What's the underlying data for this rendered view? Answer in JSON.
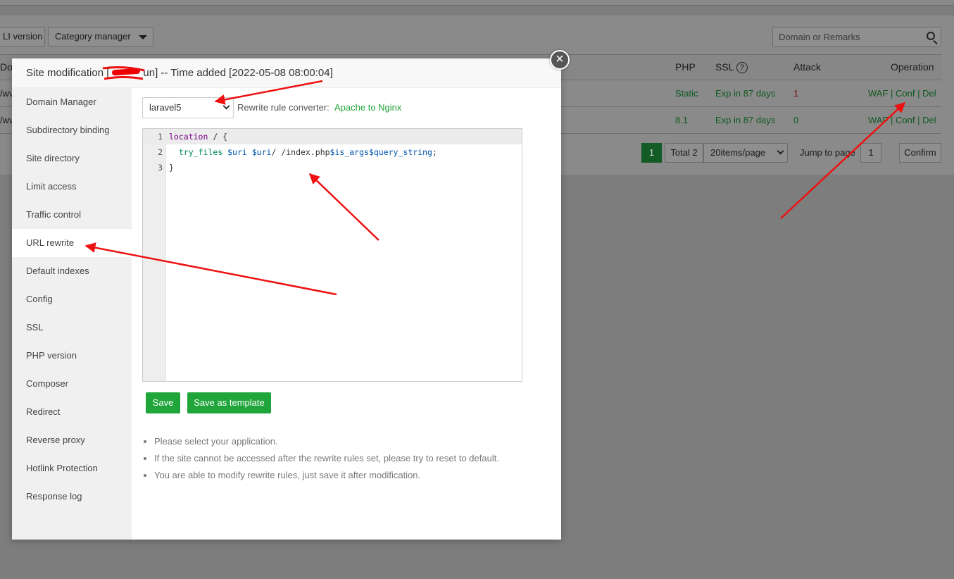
{
  "background": {
    "toolbar": {
      "cli_version_label": "LI version",
      "category_label": "Category manager"
    },
    "search": {
      "placeholder": "Domain or Remarks"
    },
    "table": {
      "columns": {
        "domain": "Do",
        "php": "PHP",
        "ssl": "SSL",
        "attack": "Attack",
        "operation": "Operation"
      },
      "rows": [
        {
          "domain": "/wv",
          "php": "Static",
          "ssl": "Exp in 87 days",
          "attack": "1",
          "op_waf": "WAF",
          "op_conf": "Conf",
          "op_del": "Del"
        },
        {
          "domain": "/wv",
          "php": "8.1",
          "ssl": "Exp in 87 days",
          "attack": "0",
          "op_waf": "WAF",
          "op_conf": "Conf",
          "op_del": "Del"
        }
      ]
    },
    "pager": {
      "current": "1",
      "total": "Total 2",
      "page_size": "20items/page",
      "jump_label": "Jump to page",
      "jump_value": "1",
      "confirm": "Confirm"
    }
  },
  "modal": {
    "title_prefix": "Site modification [",
    "title_suffix": "un] -- Time added [2022-05-08 08:00:04]",
    "close_symbol": "×",
    "sidebar": [
      "Domain Manager",
      "Subdirectory binding",
      "Site directory",
      "Limit access",
      "Traffic control",
      "URL rewrite",
      "Default indexes",
      "Config",
      "SSL",
      "PHP version",
      "Composer",
      "Redirect",
      "Reverse proxy",
      "Hotlink Protection",
      "Response log"
    ],
    "active_item": "URL rewrite",
    "rewrite": {
      "selected_template": "laravel5",
      "converter_label": "Rewrite rule converter:",
      "converter_link": "Apache to Nginx",
      "code_lines": [
        {
          "no": "1",
          "text": "location / {"
        },
        {
          "no": "2",
          "text": "  try_files $uri $uri/ /index.php$is_args$query_string;"
        },
        {
          "no": "3",
          "text": "}"
        }
      ],
      "save_label": "Save",
      "save_template_label": "Save as template",
      "tips": [
        "Please select your application.",
        "If the site cannot be accessed after the rewrite rules set, please try to reset to default.",
        "You are able to modify rewrite rules, just save it after modification."
      ]
    }
  },
  "colors": {
    "accent_green": "#20a53a",
    "annotation_red": "#ee1111",
    "overlay": "#7d7d7d"
  }
}
